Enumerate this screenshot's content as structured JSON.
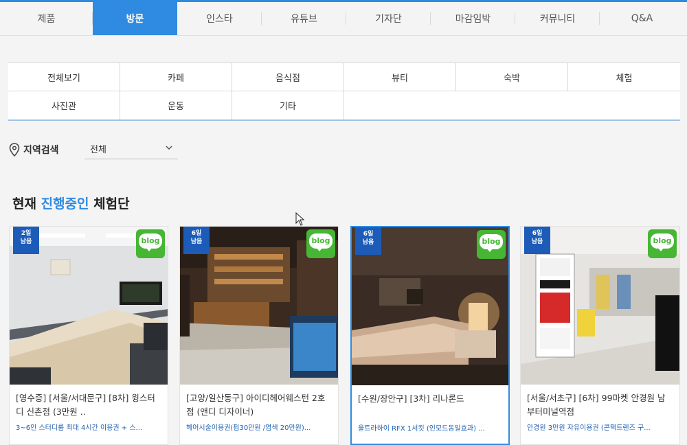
{
  "topnav": {
    "tabs": [
      "제품",
      "방문",
      "인스타",
      "유튜브",
      "기자단",
      "마감임박",
      "커뮤니티",
      "Q&A"
    ],
    "active": "방문"
  },
  "categories": {
    "row1": [
      "전체보기",
      "카페",
      "음식점",
      "뷰티",
      "숙박",
      "체험"
    ],
    "row2": [
      "사진관",
      "운동",
      "기타"
    ]
  },
  "region": {
    "label": "지역검색",
    "value": "전체"
  },
  "heading": {
    "prefix": "현재",
    "highlight": "진행중인",
    "suffix": "체험단"
  },
  "cards": [
    {
      "badge": "2일\n남음",
      "blog": "blog",
      "title": "[영수증] [서울/서대문구] [8차] 윙스터디 신촌점 (3만원 ..",
      "desc": "3~6인 스터디룸 최대 4시간 이용권 + 스..."
    },
    {
      "badge": "6일\n남음",
      "blog": "blog",
      "title": "[고양/일산동구] 아이디헤어웨스턴 2호점 (앤디 디자이너)",
      "desc": "헤어시술이용권(펌30만원 /염색 20만원)..."
    },
    {
      "badge": "6일\n남음",
      "blog": "blog",
      "title": "[수원/장안구] [3차] 리나론드",
      "desc": "울트라하이 RFX 1서킷 (인모드동일효과) ..."
    },
    {
      "badge": "6일\n남음",
      "blog": "blog",
      "title": "[서울/서초구] [6차] 99마켓 안경원 남부터미널역점",
      "desc": "안경원 3만원 자유이용권 (콘택트렌즈 구..."
    }
  ],
  "colors": {
    "accent": "#2f8be2",
    "badge": "#1c5cb8",
    "blog": "#46b634"
  }
}
